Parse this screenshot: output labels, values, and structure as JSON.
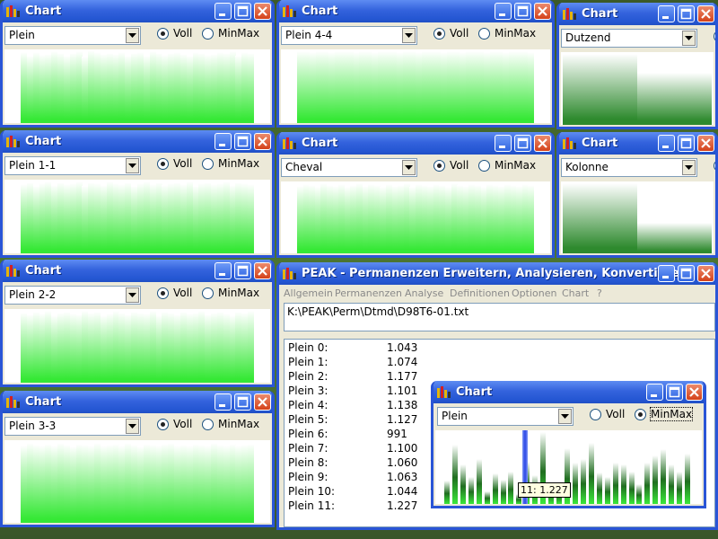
{
  "chart_window_title": "Chart",
  "radio_labels": {
    "voll": "Voll",
    "minmax": "MinMax"
  },
  "chart_windows": [
    {
      "selection": "Plein",
      "mode": "Voll",
      "bar_heights": [
        0.96,
        0.91,
        0.96,
        0.93,
        0.94,
        0.97,
        0.95,
        0.92,
        0.95,
        0.97,
        0.9,
        0.99,
        0.96,
        0.94,
        0.95,
        0.94,
        0.96,
        0.92,
        0.95,
        0.96,
        0.91,
        0.97,
        0.95,
        0.93,
        0.95,
        0.96,
        0.94,
        0.92,
        0.96,
        0.95,
        0.93,
        0.94,
        0.96,
        0.95,
        0.97,
        0.92,
        0.96,
        0.95
      ]
    },
    {
      "selection": "Plein 1-1",
      "mode": "Voll",
      "bar_heights": [
        0.94,
        0.96,
        0.92,
        0.95,
        0.97,
        0.93,
        0.96,
        0.94,
        0.95,
        0.98,
        0.92,
        0.96,
        0.95,
        0.93,
        0.97,
        0.95,
        0.94,
        0.96,
        0.92,
        0.95,
        0.97,
        0.94,
        0.96,
        0.93,
        0.95,
        0.96,
        0.94,
        0.97,
        0.92,
        0.95,
        0.96,
        0.94,
        0.95,
        0.97,
        0.93,
        0.96,
        0.95,
        0.94
      ]
    },
    {
      "selection": "Plein 2-2",
      "mode": "Voll",
      "bar_heights": [
        0.95,
        0.93,
        0.96,
        0.94,
        0.97,
        0.92,
        0.95,
        0.96,
        0.94,
        0.93,
        0.97,
        0.95,
        0.96,
        0.92,
        0.94,
        0.97,
        0.95,
        0.93,
        0.96,
        0.95,
        0.94,
        0.97,
        0.92,
        0.96,
        0.95,
        0.93,
        0.96,
        0.94,
        0.95,
        0.97,
        0.93,
        0.95,
        0.96,
        0.94,
        0.92,
        0.96,
        0.95,
        0.97
      ]
    },
    {
      "selection": "Plein 3-3",
      "mode": "Voll",
      "bar_heights": [
        0.94,
        0.97,
        0.95,
        0.93,
        0.96,
        0.94,
        0.97,
        0.95,
        0.92,
        0.96,
        0.95,
        0.94,
        0.97,
        0.93,
        0.95,
        0.96,
        0.94,
        0.97,
        0.95,
        0.92,
        0.96,
        0.95,
        0.93,
        0.96,
        0.97,
        0.94,
        0.95,
        0.93,
        0.96,
        0.95,
        0.94,
        0.97,
        0.95,
        0.93,
        0.96,
        0.94,
        0.95,
        0.96
      ]
    },
    {
      "selection": "Plein 4-4",
      "mode": "Voll",
      "bar_heights": [
        0.97,
        0.97,
        0.96,
        0.97,
        0.97,
        0.96,
        0.97,
        0.97,
        0.97,
        0.96,
        0.97,
        0.97,
        0.96,
        0.97,
        0.97,
        0.97,
        0.96,
        0.97,
        0.97,
        0.96,
        0.97,
        0.97,
        0.97,
        0.96,
        0.97,
        0.97,
        0.96,
        0.97,
        0.97,
        0.97,
        0.96,
        0.97,
        0.97,
        0.96,
        0.97,
        0.97,
        0.97,
        0.96
      ]
    },
    {
      "selection": "Cheval",
      "mode": "Voll",
      "bar_heights": [
        0.94,
        0.96,
        0.95,
        0.93,
        0.97,
        0.95,
        0.94,
        0.96,
        0.93,
        0.95,
        0.97,
        0.94,
        0.96,
        0.95,
        0.93,
        0.96,
        0.94,
        0.95,
        0.97,
        0.93,
        0.96,
        0.95,
        0.94,
        0.96,
        0.95,
        0.93,
        0.97,
        0.95,
        0.94,
        0.96,
        0.95,
        0.93,
        0.96,
        0.95,
        0.94,
        0.96,
        0.95,
        0.94,
        0.96,
        0.95
      ]
    },
    {
      "selection": "Dutzend",
      "mode": "Voll",
      "bar_heights": [
        0.97,
        0.72
      ]
    },
    {
      "selection": "Kolonne",
      "mode": "Voll",
      "bar_heights": [
        0.97,
        0.43
      ]
    }
  ],
  "peak": {
    "title": "PEAK - Permanenzen Erweitern, Analysieren, Konvertieren",
    "menu": [
      "Allgemein",
      "Permanenzen",
      "Analyse",
      "Definitionen",
      "Optionen",
      "Chart",
      "?"
    ],
    "path": "K:\\PEAK\\Perm\\Dtmd\\D98T6-01.txt",
    "rows": [
      {
        "label": "Plein   0:",
        "value": "1.043"
      },
      {
        "label": "Plein   1:",
        "value": "1.074"
      },
      {
        "label": "Plein   2:",
        "value": "1.177"
      },
      {
        "label": "Plein   3:",
        "value": "1.101"
      },
      {
        "label": "Plein   4:",
        "value": "1.138"
      },
      {
        "label": "Plein   5:",
        "value": "1.127"
      },
      {
        "label": "Plein   6:",
        "value": "991"
      },
      {
        "label": "Plein   7:",
        "value": "1.100"
      },
      {
        "label": "Plein   8:",
        "value": "1.060"
      },
      {
        "label": "Plein   9:",
        "value": "1.063"
      },
      {
        "label": "Plein 10:",
        "value": "1.044"
      },
      {
        "label": "Plein 11:",
        "value": "1.227"
      }
    ]
  },
  "minmax_chart": {
    "selection": "Plein",
    "mode": "MinMax",
    "tooltip": "11: 1.227",
    "highlighted_index": 11,
    "bar_heights": [
      0.32,
      0.82,
      0.55,
      0.37,
      0.62,
      0.18,
      0.42,
      0.34,
      0.45,
      0.14,
      0.59,
      0.4,
      1.0,
      0.3,
      0.25,
      0.78,
      0.58,
      0.62,
      0.85,
      0.44,
      0.38,
      0.58,
      0.55,
      0.45,
      0.28,
      0.58,
      0.68,
      0.76,
      0.55,
      0.45,
      0.7
    ]
  }
}
